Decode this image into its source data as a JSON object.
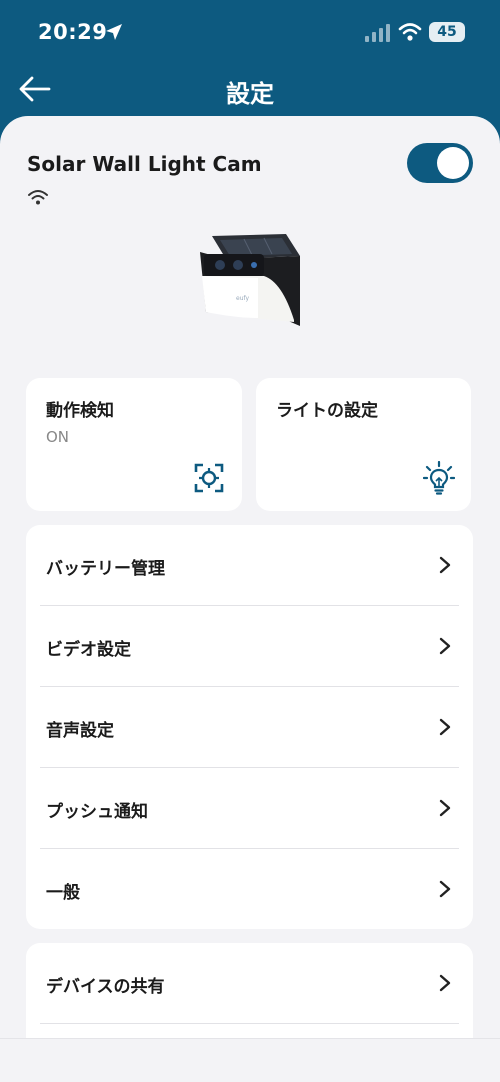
{
  "status_bar": {
    "time": "20:29",
    "battery": "45",
    "icons": [
      "location-arrow-icon",
      "cell-signal-icon",
      "wifi-icon",
      "battery-icon"
    ]
  },
  "nav": {
    "title": "設定",
    "back_icon": "back-arrow-icon"
  },
  "device": {
    "name": "Solar Wall Light Cam",
    "connection_icon": "wifi-icon",
    "power_on": true
  },
  "quick_cards": [
    {
      "title": "動作検知",
      "subtitle": "ON",
      "icon": "motion-detect-icon"
    },
    {
      "title": "ライトの設定",
      "icon": "lightbulb-icon"
    }
  ],
  "settings_list": [
    {
      "label": "バッテリー管理"
    },
    {
      "label": "ビデオ設定"
    },
    {
      "label": "音声設定"
    },
    {
      "label": "プッシュ通知"
    },
    {
      "label": "一般"
    }
  ],
  "settings_list_2": [
    {
      "label": "デバイスの共有"
    }
  ],
  "colors": {
    "brand": "#0d5a80",
    "background": "#f3f3f6",
    "card": "#ffffff"
  }
}
